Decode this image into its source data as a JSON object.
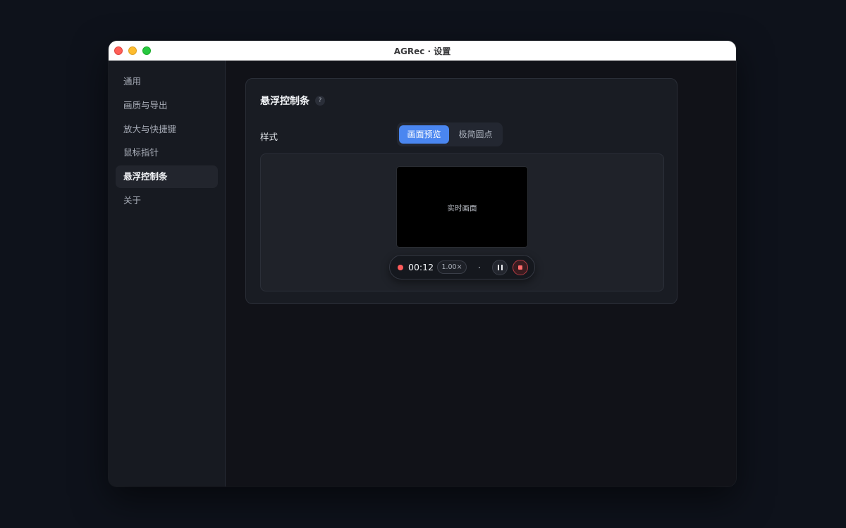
{
  "window": {
    "title": "AGRec · 设置"
  },
  "sidebar": {
    "items": [
      {
        "label": "通用"
      },
      {
        "label": "画质与导出"
      },
      {
        "label": "放大与快捷键"
      },
      {
        "label": "鼠标指针"
      },
      {
        "label": "悬浮控制条",
        "active": true
      },
      {
        "label": "关于"
      }
    ]
  },
  "section": {
    "title": "悬浮控制条",
    "help_glyph": "?",
    "style_label": "样式",
    "style_options": [
      {
        "label": "画面预览",
        "selected": true
      },
      {
        "label": "极简圆点",
        "selected": false
      }
    ]
  },
  "preview": {
    "video_label": "实时画面",
    "control_bar": {
      "timer": "00:12",
      "zoom": "1.00×"
    }
  },
  "colors": {
    "accent": "#4a86f0",
    "record": "#ff5b5b"
  }
}
